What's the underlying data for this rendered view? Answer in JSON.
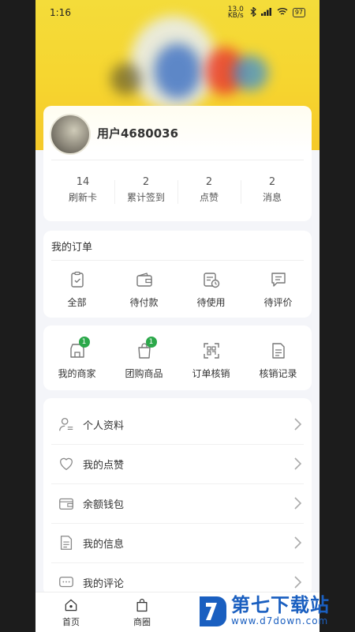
{
  "status_bar": {
    "time": "1:16",
    "net_speed": "13.0 KB/s",
    "battery": "97"
  },
  "profile": {
    "username": "用户4680036"
  },
  "stats": [
    {
      "value": "14",
      "label": "刷新卡"
    },
    {
      "value": "2",
      "label": "累计签到"
    },
    {
      "value": "2",
      "label": "点赞"
    },
    {
      "value": "2",
      "label": "消息"
    }
  ],
  "orders": {
    "title": "我的订单",
    "items": [
      {
        "label": "全部",
        "icon": "clipboard-check-icon"
      },
      {
        "label": "待付款",
        "icon": "wallet-icon"
      },
      {
        "label": "待使用",
        "icon": "calendar-clock-icon"
      },
      {
        "label": "待评价",
        "icon": "chat-lines-icon"
      }
    ]
  },
  "tools": [
    {
      "label": "我的商家",
      "icon": "shop-icon",
      "badge": "1"
    },
    {
      "label": "团购商品",
      "icon": "shopping-bag-icon",
      "badge": "1"
    },
    {
      "label": "订单核销",
      "icon": "qr-scan-icon",
      "badge": ""
    },
    {
      "label": "核销记录",
      "icon": "document-icon",
      "badge": ""
    }
  ],
  "menu": [
    {
      "label": "个人资料",
      "icon": "person-icon"
    },
    {
      "label": "我的点赞",
      "icon": "heart-icon"
    },
    {
      "label": "余额钱包",
      "icon": "wallet-icon"
    },
    {
      "label": "我的信息",
      "icon": "document-icon"
    },
    {
      "label": "我的评论",
      "icon": "comment-icon"
    }
  ],
  "tabbar": [
    {
      "label": "首页",
      "icon": "home-icon"
    },
    {
      "label": "商圈",
      "icon": "bag-icon"
    }
  ],
  "watermark": {
    "title": "第七下载站",
    "url": "www.d7down.com"
  },
  "colors": {
    "banner": "#f6d52f",
    "badge": "#2ba84a",
    "watermark": "#1a5fc0"
  }
}
